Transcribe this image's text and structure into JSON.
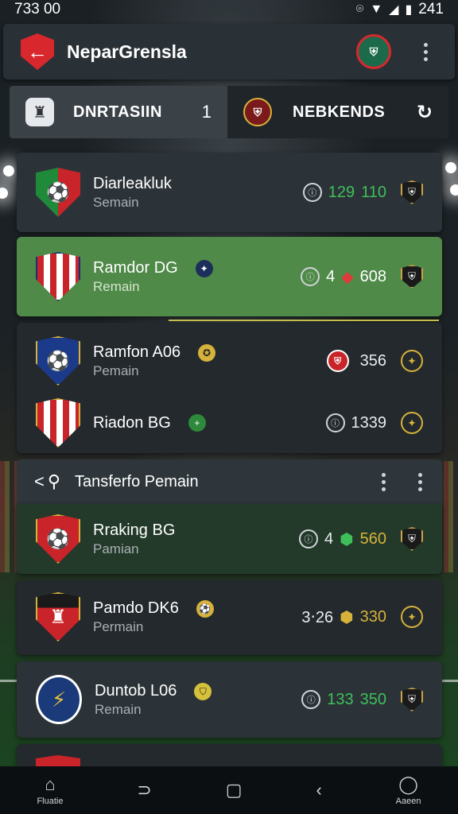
{
  "status_bar": {
    "time": "733 00",
    "right_text": "241"
  },
  "app_bar": {
    "title": "NeparGrensla"
  },
  "tabs": [
    {
      "label": "DNRTASIIN",
      "count": "1"
    },
    {
      "label": "NEBKENDS"
    }
  ],
  "teams": [
    {
      "name": "Diarleakluk",
      "sub": "Semain",
      "stat_a": "129",
      "stat_b": "110"
    },
    {
      "name": "Ramdor DG",
      "sub": "Remain",
      "stat_a": "4",
      "stat_b": "608"
    },
    {
      "name": "Ramfon A06",
      "sub": "Pemain",
      "stat_b": "356"
    },
    {
      "name": "Riadon BG",
      "sub": "",
      "stat_b": "1339"
    }
  ],
  "section": {
    "title": "Tansferfo Pemain"
  },
  "transfers": [
    {
      "name": "Rraking BG",
      "sub": "Pamian",
      "stat_a": "4",
      "stat_b": "560"
    },
    {
      "name": "Pamdo DK6",
      "sub": "Permain",
      "stat_a": "3‧26",
      "stat_b": "330"
    },
    {
      "name": "Duntob L06",
      "sub": "Remain",
      "stat_a": "133",
      "stat_b": "350"
    }
  ],
  "bottom_nav": {
    "home_label": "Fluatie",
    "profile_label": "Aaeen"
  },
  "colors": {
    "accent_red": "#d8282e",
    "green_highlight": "#4f8a48",
    "stat_green": "#3fbf5a",
    "stat_gold": "#d6b23a"
  }
}
